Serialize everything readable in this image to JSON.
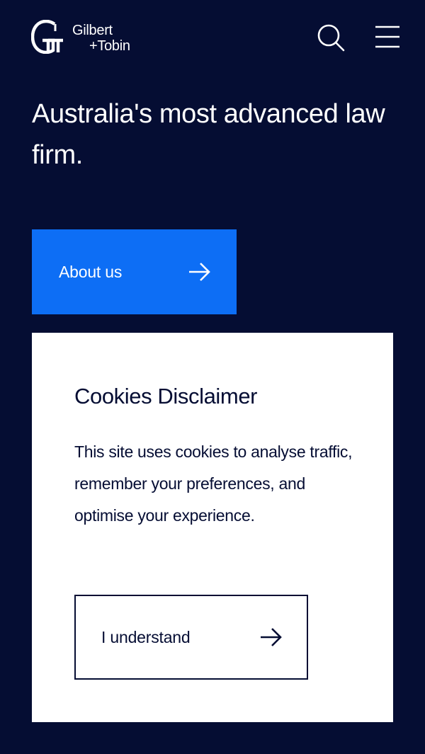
{
  "brand": {
    "name_line1": "Gilbert",
    "name_line2": "+Tobin",
    "logo_icon": "gilbert-tobin-logo-icon"
  },
  "header": {
    "search_icon": "search-icon",
    "menu_icon": "hamburger-menu-icon"
  },
  "hero": {
    "title": "Australia's most advanced law firm.",
    "cta_label": "About us",
    "cta_icon": "arrow-right-icon"
  },
  "cookie": {
    "title": "Cookies Disclaimer",
    "text": "This site uses cookies to analyse traffic, remember your preferences, and optimise your experience.",
    "button_label": "I understand",
    "button_icon": "arrow-right-icon"
  },
  "colors": {
    "background": "#050d33",
    "accent": "#0d6ef5",
    "card": "#ffffff",
    "text_dark": "#050d33"
  }
}
